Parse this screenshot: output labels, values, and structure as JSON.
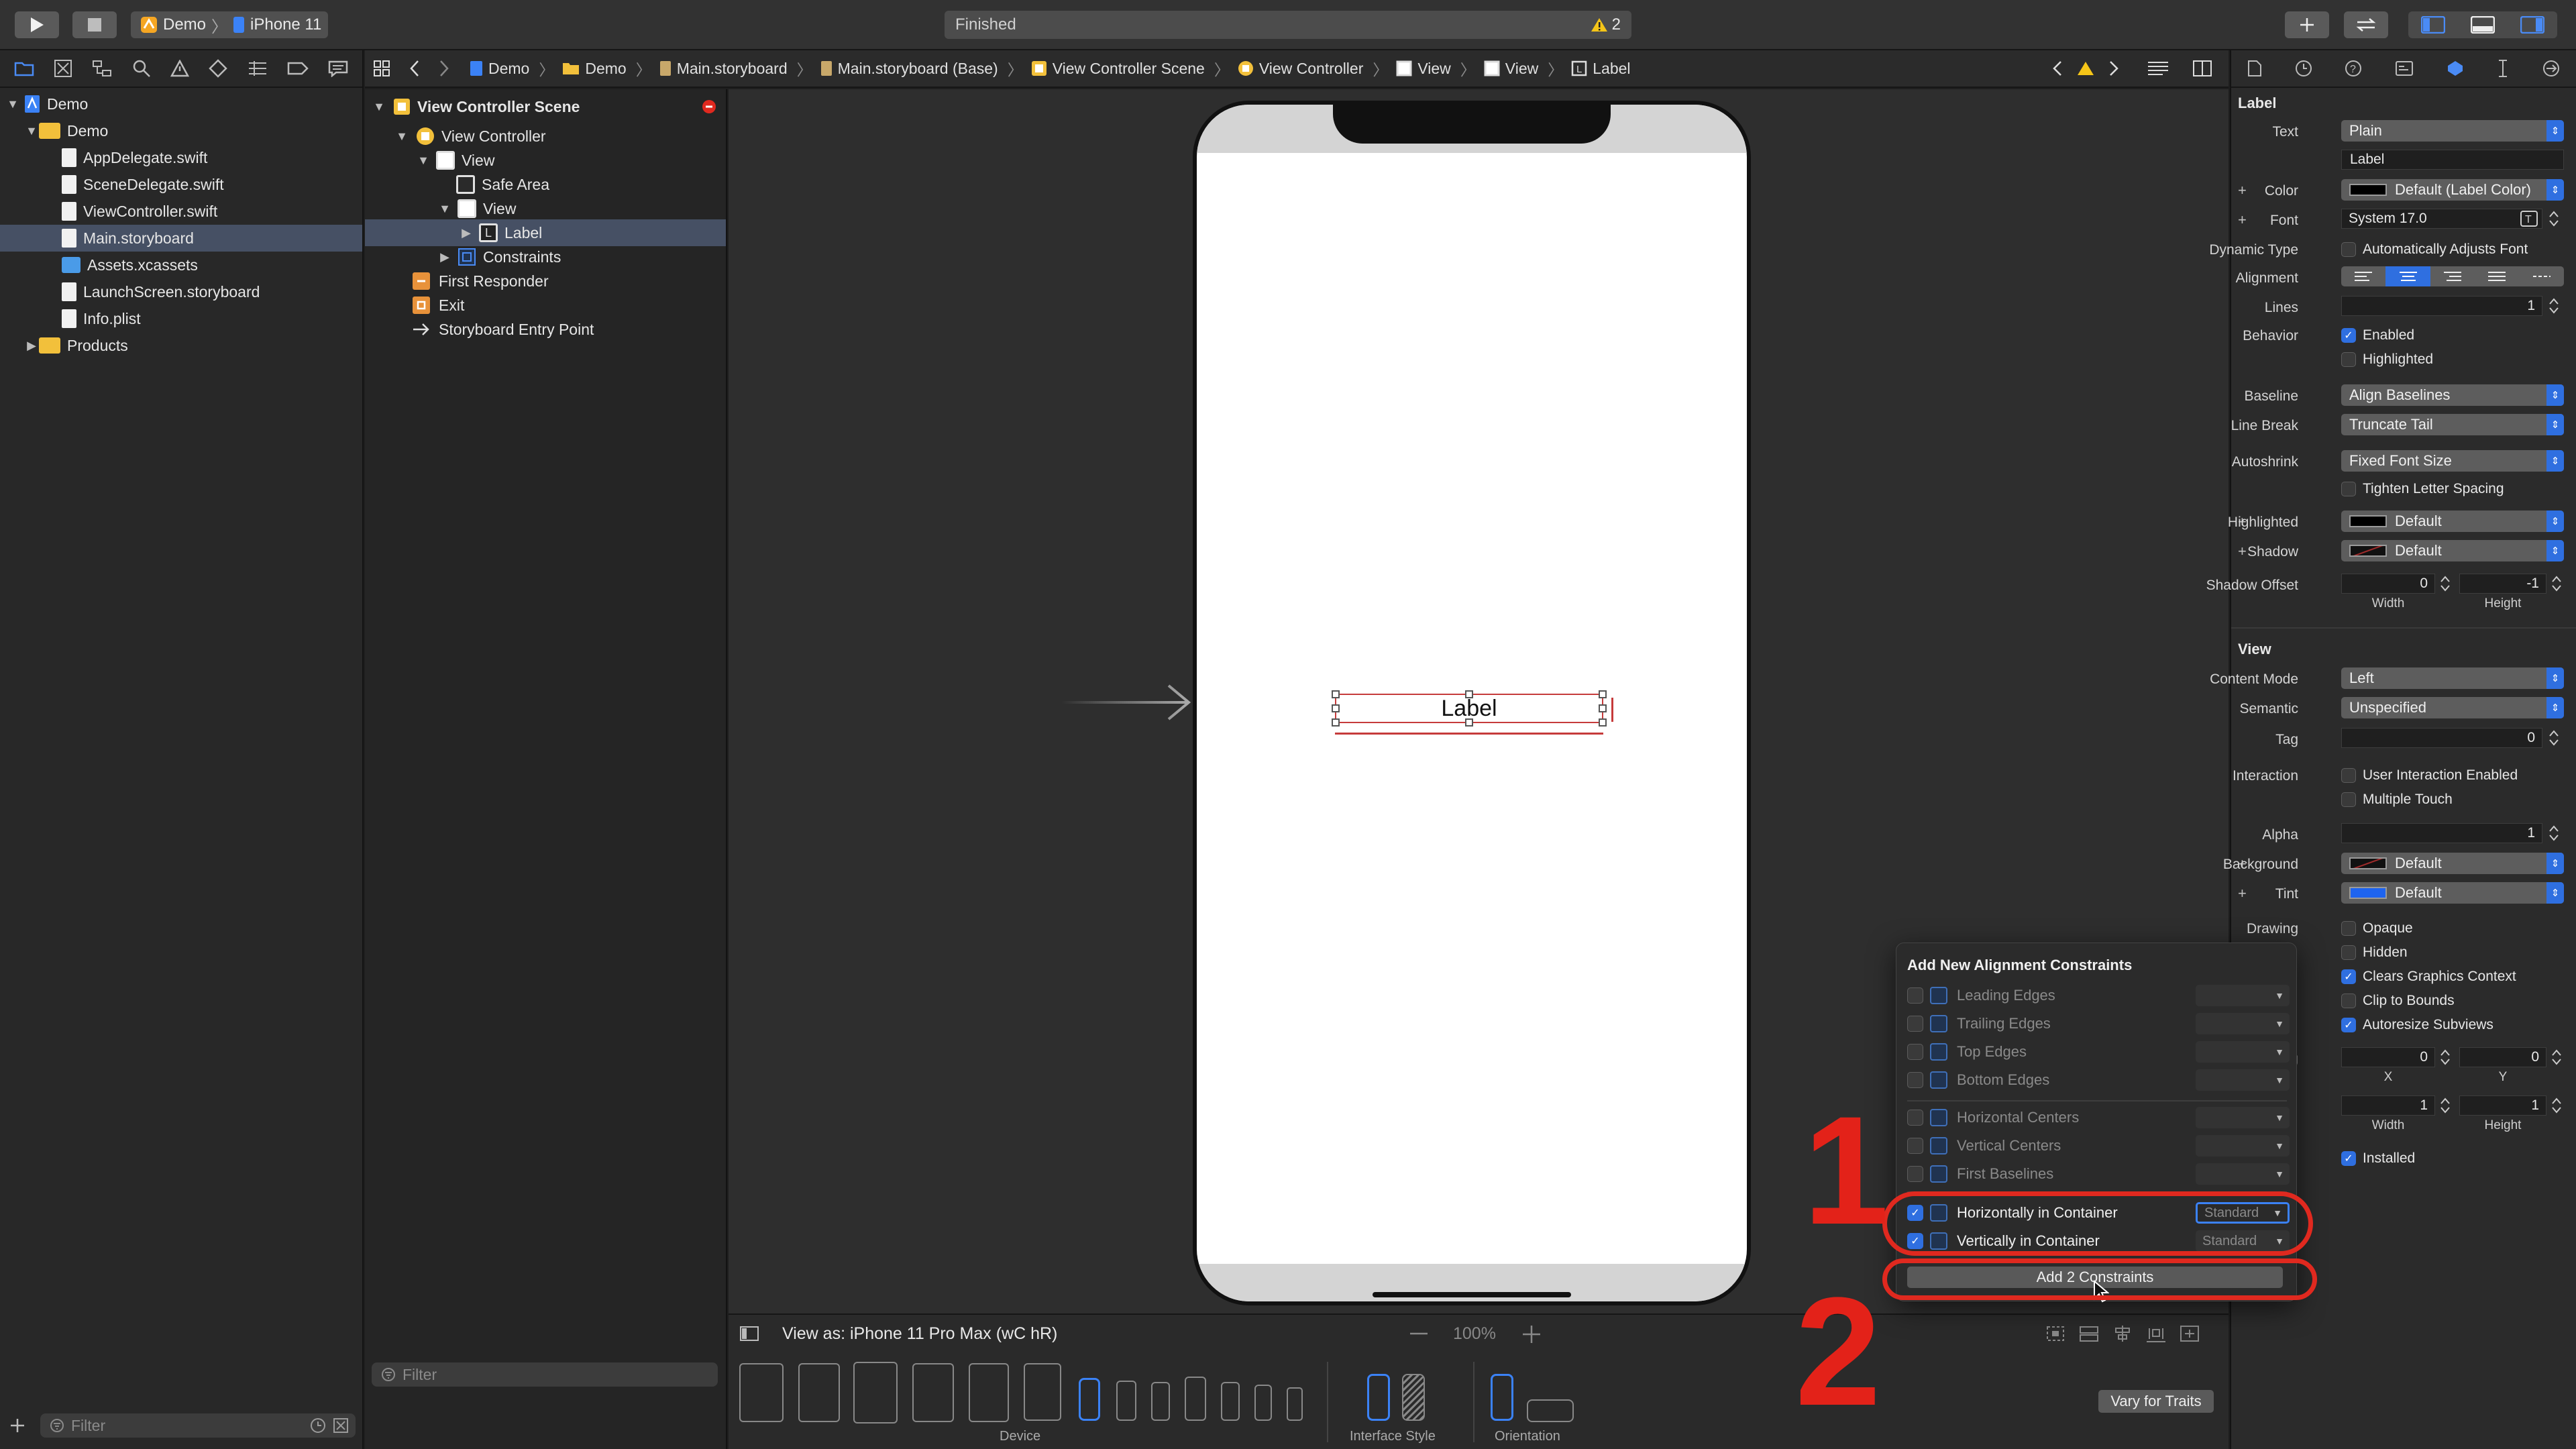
{
  "toolbar": {
    "scheme_project": "Demo",
    "scheme_device": "iPhone 11",
    "status_text": "Finished",
    "warning_count": "2"
  },
  "navigator": {
    "items": [
      {
        "label": "Demo",
        "kind": "project"
      },
      {
        "label": "Demo",
        "kind": "folder"
      },
      {
        "label": "AppDelegate.swift",
        "kind": "file"
      },
      {
        "label": "SceneDelegate.swift",
        "kind": "file"
      },
      {
        "label": "ViewController.swift",
        "kind": "file"
      },
      {
        "label": "Main.storyboard",
        "kind": "file",
        "selected": true
      },
      {
        "label": "Assets.xcassets",
        "kind": "folder"
      },
      {
        "label": "LaunchScreen.storyboard",
        "kind": "file"
      },
      {
        "label": "Info.plist",
        "kind": "file"
      },
      {
        "label": "Products",
        "kind": "folder"
      }
    ],
    "filter_placeholder": "Filter"
  },
  "jumpbar": {
    "crumbs": [
      "Demo",
      "Demo",
      "Main.storyboard",
      "Main.storyboard (Base)",
      "View Controller Scene",
      "View Controller",
      "View",
      "View",
      "Label"
    ]
  },
  "outline": {
    "items": [
      {
        "label": "View Controller Scene"
      },
      {
        "label": "View Controller"
      },
      {
        "label": "View"
      },
      {
        "label": "Safe Area"
      },
      {
        "label": "View"
      },
      {
        "label": "Label",
        "selected": true
      },
      {
        "label": "Constraints"
      },
      {
        "label": "First Responder"
      },
      {
        "label": "Exit"
      },
      {
        "label": "Storyboard Entry Point"
      }
    ],
    "filter_placeholder": "Filter"
  },
  "canvas": {
    "label_text": "Label"
  },
  "canvas_bar": {
    "view_as": "View as: iPhone 11 Pro Max (wC hR)",
    "zoom": "100%",
    "device_label": "Device",
    "interface_style_label": "Interface Style",
    "orientation_label": "Orientation",
    "vary_button": "Vary for Traits"
  },
  "inspector": {
    "label_section": "Label",
    "text_label": "Text",
    "text_value": "Plain",
    "label_field": "Label",
    "color_label": "Color",
    "color_value": "Default (Label Color)",
    "font_label": "Font",
    "font_value": "System 17.0",
    "dynamic_type_label": "Dynamic Type",
    "dynamic_type_value": "Automatically Adjusts Font",
    "alignment_label": "Alignment",
    "lines_label": "Lines",
    "lines_value": "1",
    "behavior_label": "Behavior",
    "enabled": "Enabled",
    "highlighted_chk": "Highlighted",
    "baseline_label": "Baseline",
    "baseline_value": "Align Baselines",
    "line_break_label": "Line Break",
    "line_break_value": "Truncate Tail",
    "autoshrink_label": "Autoshrink",
    "autoshrink_value": "Fixed Font Size",
    "tighten": "Tighten Letter Spacing",
    "highlighted_label": "Highlighted",
    "highlighted_value": "Default",
    "shadow_label": "Shadow",
    "shadow_value": "Default",
    "shadow_offset_label": "Shadow Offset",
    "shadow_w": "0",
    "shadow_h": "-1",
    "width_lbl": "Width",
    "height_lbl": "Height",
    "view_section": "View",
    "content_mode_label": "Content Mode",
    "content_mode_value": "Left",
    "semantic_label": "Semantic",
    "semantic_value": "Unspecified",
    "tag_label": "Tag",
    "tag_value": "0",
    "interaction_label": "Interaction",
    "user_interaction": "User Interaction Enabled",
    "multiple_touch": "Multiple Touch",
    "alpha_label": "Alpha",
    "alpha_value": "1",
    "background_label": "Background",
    "background_value": "Default",
    "tint_label": "Tint",
    "tint_value": "Default",
    "drawing_label": "Drawing",
    "opaque": "Opaque",
    "hidden": "Hidden",
    "clears_graphics": "Clears Graphics Context",
    "clip_bounds": "Clip to Bounds",
    "autoresize": "Autoresize Subviews",
    "stretching_label": "tching",
    "stretch_x": "0",
    "stretch_y": "0",
    "x_lbl": "X",
    "y_lbl": "Y",
    "stretch_w": "1",
    "stretch_h": "1",
    "installed": "Installed"
  },
  "popover": {
    "title": "Add New Alignment Constraints",
    "rows": [
      {
        "label": "Leading Edges",
        "checked": false,
        "value": ""
      },
      {
        "label": "Trailing Edges",
        "checked": false,
        "value": ""
      },
      {
        "label": "Top Edges",
        "checked": false,
        "value": ""
      },
      {
        "label": "Bottom Edges",
        "checked": false,
        "value": ""
      },
      {
        "label": "Horizontal Centers",
        "checked": false,
        "value": ""
      },
      {
        "label": "Vertical Centers",
        "checked": false,
        "value": ""
      },
      {
        "label": "First Baselines",
        "checked": false,
        "value": ""
      },
      {
        "label": "Horizontally in Container",
        "checked": true,
        "value": "Standard"
      },
      {
        "label": "Vertically in Container",
        "checked": true,
        "value": "Standard"
      }
    ],
    "add_button": "Add 2 Constraints"
  },
  "annotations": {
    "step1": "1",
    "step2": "2",
    "color": "#e0291f"
  },
  "colors": {
    "accent": "#2f6fe0",
    "selection": "#465064",
    "canvas": "#2e2e2e"
  }
}
